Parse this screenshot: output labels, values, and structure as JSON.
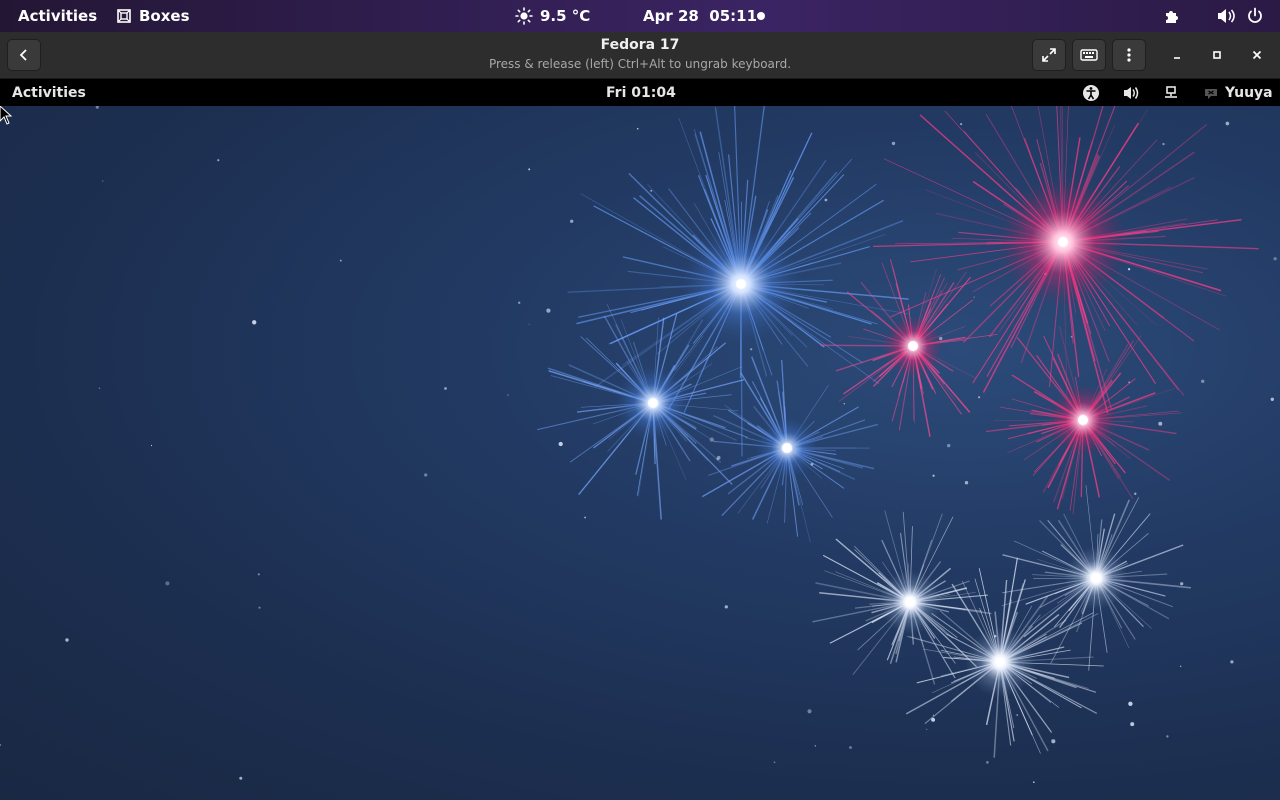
{
  "host_topbar": {
    "activities_label": "Activities",
    "app_name": "Boxes",
    "app_icon": "boxes-icon",
    "weather_icon": "sun-icon",
    "weather_temp": "9.5 °C",
    "clock": "Apr 28  05:11",
    "notification_dot_icon": "notification-dot-icon",
    "extension_icon": "puzzle-icon",
    "volume_icon": "volume-icon",
    "power_icon": "power-icon"
  },
  "boxes_header": {
    "back_icon": "chevron-left-icon",
    "title": "Fedora 17",
    "subtitle": "Press & release (left) Ctrl+Alt to ungrab keyboard.",
    "fullscreen_icon": "fullscreen-icon",
    "keyboard_icon": "keyboard-icon",
    "menu_icon": "kebab-menu-icon",
    "minimize_icon": "minimize-icon",
    "maximize_icon": "maximize-icon",
    "close_icon": "close-icon"
  },
  "guest_panel": {
    "activities_label": "Activities",
    "clock": "Fri 01:04",
    "accessibility_icon": "accessibility-icon",
    "volume_icon": "volume-icon",
    "network_icon": "network-wired-icon",
    "user_icon": "user-status-icon",
    "user_name": "Yuuya"
  },
  "guest_desktop": {
    "wallpaper": "fireworks",
    "cursor_icon": "mouse-pointer-icon"
  },
  "colors": {
    "host_bar": "#2f1d4d",
    "header_bar": "#2d2d2d",
    "guest_panel": "#000000",
    "desktop": "#1c2e4f",
    "firework_blue": "#6aa0ff",
    "firework_pink": "#ff3d8a",
    "firework_white": "#e6eeff"
  }
}
